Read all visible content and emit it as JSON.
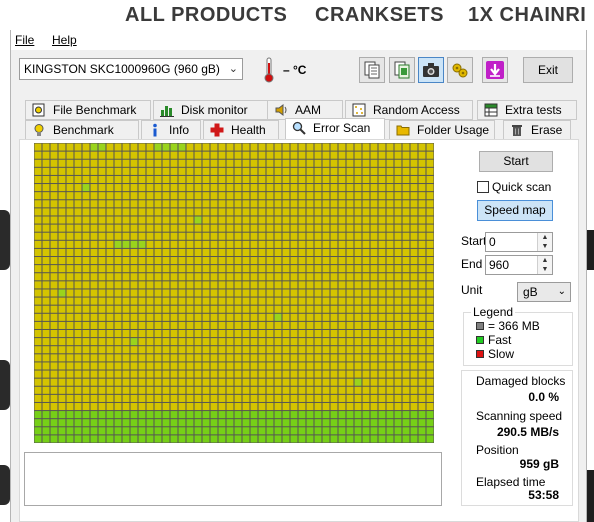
{
  "website": {
    "nav": [
      "ALL PRODUCTS",
      "CRANKSETS",
      "1X CHAINRI"
    ]
  },
  "menu": {
    "file": "File",
    "help": "Help"
  },
  "toolbar": {
    "drive": "KINGSTON SKC1000960G (960 gB)",
    "temperature": "– °C",
    "exit_label": "Exit"
  },
  "tabs_top": [
    "File Benchmark",
    "Disk monitor",
    "AAM",
    "Random Access",
    "Extra tests"
  ],
  "tabs_bottom": [
    "Benchmark",
    "Info",
    "Health",
    "Error Scan",
    "Folder Usage",
    "Erase"
  ],
  "active_tab": "Error Scan",
  "scan": {
    "start_button": "Start",
    "quick_scan_label": "Quick scan",
    "quick_scan_checked": false,
    "speed_map_button": "Speed map",
    "start_label": "Start",
    "start_value": "0",
    "end_label": "End",
    "end_value": "960",
    "unit_label": "Unit",
    "unit_value": "gB"
  },
  "legend": {
    "title": "Legend",
    "block_size": "= 366 MB",
    "fast": "Fast",
    "slow": "Slow",
    "colors": {
      "block": "#808080",
      "fast": "#22cc22",
      "slow": "#dd1111",
      "grid_yellow": "#d4c400",
      "grid_lightgreen": "#9ad41c",
      "grid_green": "#76d017"
    }
  },
  "stats": {
    "damaged_label": "Damaged blocks",
    "damaged_value": "0.0 %",
    "speed_label": "Scanning speed",
    "speed_value": "290.5 MB/s",
    "position_label": "Position",
    "position_value": "959 gB",
    "elapsed_label": "Elapsed time",
    "elapsed_value": "53:58"
  }
}
